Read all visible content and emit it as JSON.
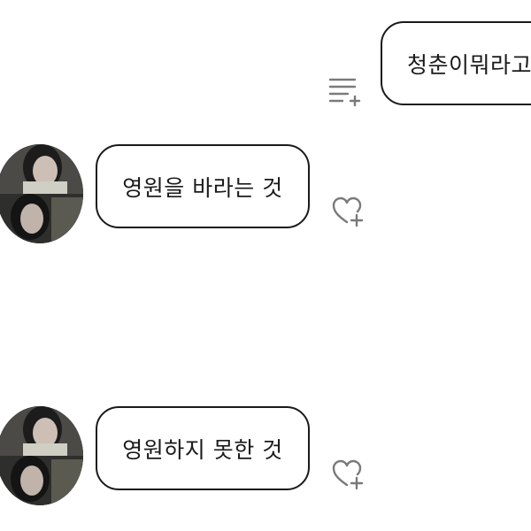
{
  "chat": {
    "messages": [
      {
        "sender": "me",
        "text": "청춘이뭐라고"
      },
      {
        "sender": "other",
        "text": "영원을 바라는 것"
      },
      {
        "sender": "other",
        "text": "영원하지 못한 것"
      }
    ]
  },
  "icons": {
    "outgoing_action": "translate-icon",
    "incoming_action": "heart-plus-icon"
  },
  "colors": {
    "bubble_border": "#1a1a1a",
    "icon": "#7a7a7a",
    "background": "#ffffff"
  }
}
